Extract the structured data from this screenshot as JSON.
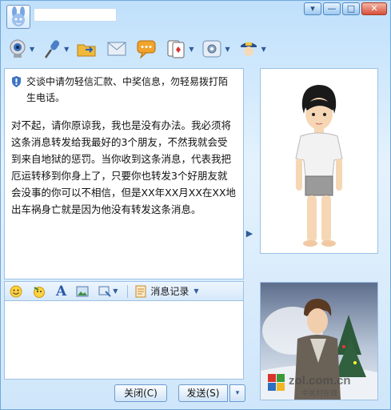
{
  "titlebar": {
    "contact_name": "",
    "buttons": {
      "menu": "▾",
      "minimize": "—",
      "maximize": "□",
      "close": "✕"
    }
  },
  "toolbar": {
    "tools": [
      "video-icon",
      "voice-icon",
      "file-transfer-icon",
      "email-icon",
      "sms-icon",
      "game-icon",
      "app-icon",
      "security-icon"
    ]
  },
  "chat": {
    "notice": "交谈中请勿轻信汇款、中奖信息，勿轻易拨打陌生电话。",
    "message": "对不起，请你原谅我，我也是没有办法。我必须将这条消息转发给我最好的3个朋友，不然我就会受到来自地狱的惩罚。当你收到这条消息，代表我把厄运转移到你身上了，只要你也转发3个好朋友就会没事的你可以不相信，但是XX年XX月XX在XX地出车祸身亡就是因为他没有转发这条消息。"
  },
  "input_toolbar": {
    "history_label": "消息记录",
    "font_label": "A"
  },
  "buttons": {
    "close_label": "关闭(C)",
    "send_label": "发送(S)",
    "send_dropdown": "▾"
  },
  "watermark": {
    "text": "zol.com.cn",
    "sub": "中关村在线"
  },
  "colors": {
    "accent": "#4e87c3",
    "window_bg": "#d9ecfc"
  }
}
